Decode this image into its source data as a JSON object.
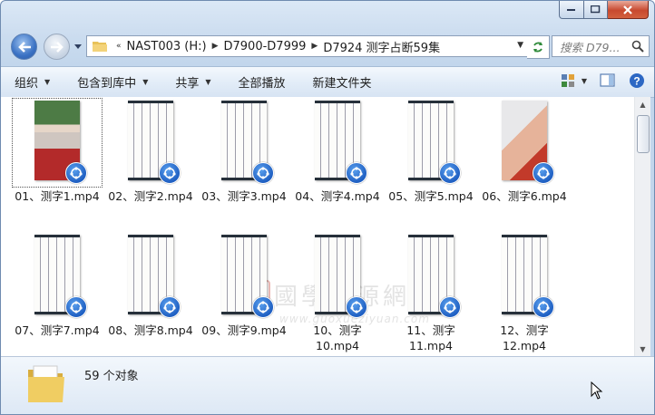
{
  "window": {
    "caption_buttons": [
      "minimize",
      "maximize",
      "close"
    ]
  },
  "address_bar": {
    "overflow_chevron": "«",
    "crumbs": [
      "NAST003 (H:)",
      "D7900-D7999",
      "D7924 测字占断59集"
    ]
  },
  "search": {
    "placeholder": "搜索 D79..."
  },
  "toolbar": {
    "organize": "组织",
    "include_in_library": "包含到库中",
    "share": "共享",
    "play_all": "全部播放",
    "new_folder": "新建文件夹"
  },
  "files": [
    {
      "name": "01、测字1.mp4",
      "thumb": "teacher"
    },
    {
      "name": "02、测字2.mp4",
      "thumb": "doc"
    },
    {
      "name": "03、测字3.mp4",
      "thumb": "doc"
    },
    {
      "name": "04、测字4.mp4",
      "thumb": "doc"
    },
    {
      "name": "05、测字5.mp4",
      "thumb": "doc"
    },
    {
      "name": "06、测字6.mp4",
      "thumb": "face"
    },
    {
      "name": "07、测字7.mp4",
      "thumb": "doc"
    },
    {
      "name": "08、测字8.mp4",
      "thumb": "doc"
    },
    {
      "name": "09、测字9.mp4",
      "thumb": "doc"
    },
    {
      "name": "10、测字\n10.mp4",
      "thumb": "doc"
    },
    {
      "name": "11、测字\n11.mp4",
      "thumb": "doc"
    },
    {
      "name": "12、测字\n12.mp4",
      "thumb": "doc"
    }
  ],
  "watermark": {
    "seal": "臨",
    "text": "國學資源網",
    "url": "www.guoxueziyuan.com"
  },
  "details": {
    "count_text": "59 个对象"
  },
  "colors": {
    "badge": "#1f5fc2",
    "close_button": "#c8492f"
  }
}
